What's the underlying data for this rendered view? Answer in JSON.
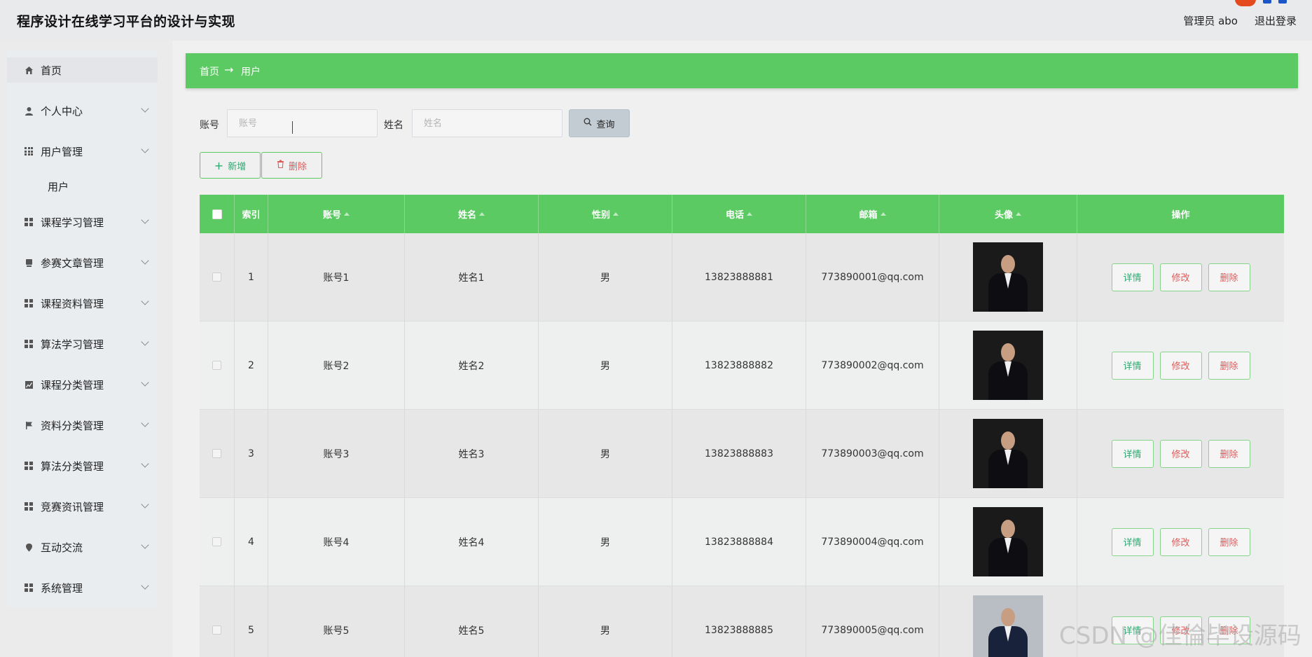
{
  "app": {
    "title": "程序设计在线学习平台的设计与实现",
    "admin_label": "管理员 abo",
    "logout_label": "退出登录"
  },
  "sidebar": {
    "items": [
      {
        "label": "首页",
        "icon": "home-icon"
      },
      {
        "label": "个人中心",
        "icon": "user-icon"
      },
      {
        "label": "用户管理",
        "icon": "grid-icon"
      },
      {
        "label": "课程学习管理",
        "icon": "grid-icon"
      },
      {
        "label": "参赛文章管理",
        "icon": "document-icon"
      },
      {
        "label": "课程资料管理",
        "icon": "grid-icon"
      },
      {
        "label": "算法学习管理",
        "icon": "grid-icon"
      },
      {
        "label": "课程分类管理",
        "icon": "chart-icon"
      },
      {
        "label": "资料分类管理",
        "icon": "flag-icon"
      },
      {
        "label": "算法分类管理",
        "icon": "grid-icon"
      },
      {
        "label": "竞赛资讯管理",
        "icon": "grid-icon"
      },
      {
        "label": "互动交流",
        "icon": "location-icon"
      },
      {
        "label": "系统管理",
        "icon": "grid-icon"
      }
    ],
    "sub_user": "用户"
  },
  "breadcrumb": {
    "home": "首页",
    "arrow": "→",
    "current": "用户"
  },
  "search": {
    "account_label": "账号",
    "account_placeholder": "账号",
    "name_label": "姓名",
    "name_placeholder": "姓名",
    "query_label": "查询"
  },
  "actions": {
    "add_label": "新增",
    "delete_label": "删除"
  },
  "table": {
    "columns": [
      "索引",
      "账号",
      "姓名",
      "性别",
      "电话",
      "邮箱",
      "头像",
      "操作"
    ],
    "rows": [
      {
        "index": "1",
        "account": "账号1",
        "name": "姓名1",
        "gender": "男",
        "phone": "13823888881",
        "email": "773890001@qq.com"
      },
      {
        "index": "2",
        "account": "账号2",
        "name": "姓名2",
        "gender": "男",
        "phone": "13823888882",
        "email": "773890002@qq.com"
      },
      {
        "index": "3",
        "account": "账号3",
        "name": "姓名3",
        "gender": "男",
        "phone": "13823888883",
        "email": "773890003@qq.com"
      },
      {
        "index": "4",
        "account": "账号4",
        "name": "姓名4",
        "gender": "男",
        "phone": "13823888884",
        "email": "773890004@qq.com"
      },
      {
        "index": "5",
        "account": "账号5",
        "name": "姓名5",
        "gender": "男",
        "phone": "13823888885",
        "email": "773890005@qq.com"
      }
    ],
    "detail_label": "详情",
    "edit_label": "修改",
    "remove_label": "删除"
  },
  "watermark": "CSDN @佳倫毕设源码",
  "colors": {
    "accent": "#5cca62",
    "danger": "#e05a5a",
    "detail": "#2ea76f"
  }
}
